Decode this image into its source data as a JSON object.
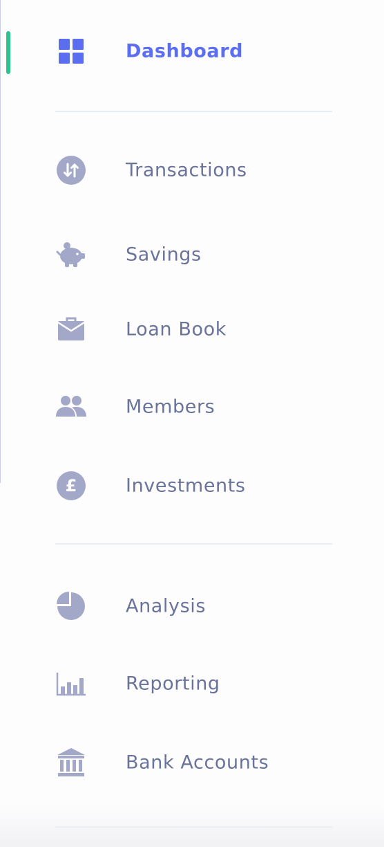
{
  "colors": {
    "active_accent": "#2ec38c",
    "active_text": "#5b6ef0",
    "icon": "#a3a8c9",
    "label": "#6a739a",
    "divider": "#e6f0f2"
  },
  "nav": {
    "items": [
      {
        "label": "Dashboard",
        "icon": "grid-icon",
        "active": true
      },
      {
        "label": "Transactions",
        "icon": "arrows-updown-icon",
        "active": false
      },
      {
        "label": "Savings",
        "icon": "piggy-bank-icon",
        "active": false
      },
      {
        "label": "Loan Book",
        "icon": "briefcase-icon",
        "active": false
      },
      {
        "label": "Members",
        "icon": "users-icon",
        "active": false
      },
      {
        "label": "Investments",
        "icon": "pound-coin-icon",
        "active": false
      },
      {
        "label": "Analysis",
        "icon": "pie-chart-icon",
        "active": false
      },
      {
        "label": "Reporting",
        "icon": "bar-chart-icon",
        "active": false
      },
      {
        "label": "Bank Accounts",
        "icon": "bank-icon",
        "active": false
      }
    ]
  }
}
